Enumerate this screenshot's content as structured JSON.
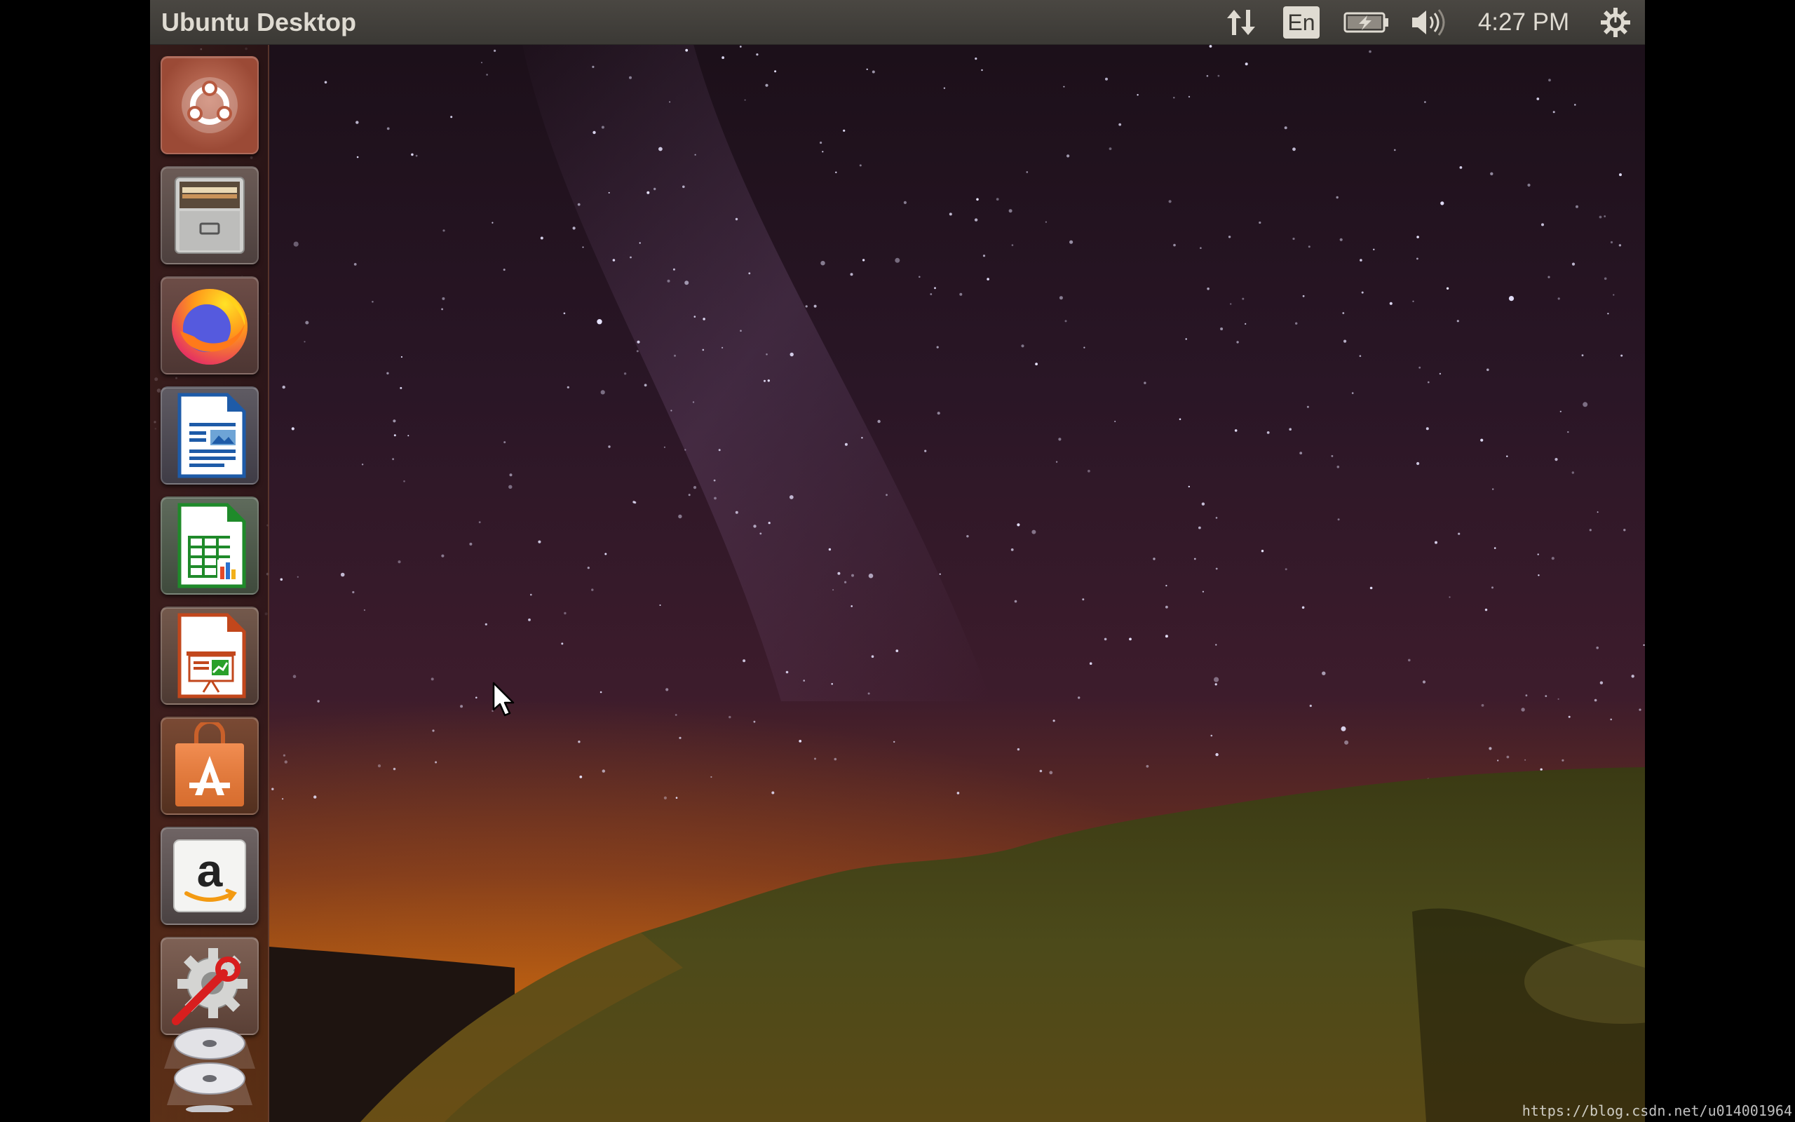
{
  "panel": {
    "title": "Ubuntu Desktop",
    "keyboard_layout": "En",
    "clock": "4:27 PM",
    "indicators": [
      "network-updown-icon",
      "keyboard-layout-indicator",
      "battery-charging-icon",
      "volume-icon",
      "clock",
      "session-gear-icon"
    ]
  },
  "launcher": {
    "items": [
      {
        "name": "Search your computer",
        "icon": "ubuntu-dash-icon"
      },
      {
        "name": "Files",
        "icon": "file-cabinet-icon"
      },
      {
        "name": "Firefox Web Browser",
        "icon": "firefox-icon"
      },
      {
        "name": "LibreOffice Writer",
        "icon": "libreoffice-writer-icon"
      },
      {
        "name": "LibreOffice Calc",
        "icon": "libreoffice-calc-icon"
      },
      {
        "name": "LibreOffice Impress",
        "icon": "libreoffice-impress-icon"
      },
      {
        "name": "Ubuntu Software",
        "icon": "shopping-bag-icon"
      },
      {
        "name": "Amazon",
        "icon": "amazon-icon"
      },
      {
        "name": "System Settings",
        "icon": "settings-wrench-gear-icon"
      },
      {
        "name": "Disc drives",
        "icon": "cd-disc-icon"
      }
    ]
  },
  "watermark": "https://blog.csdn.net/u014001964",
  "colors": {
    "panel_bg": "#3b3935",
    "panel_text": "#dfdbd2",
    "launcher_tint": "#3c1e19"
  }
}
